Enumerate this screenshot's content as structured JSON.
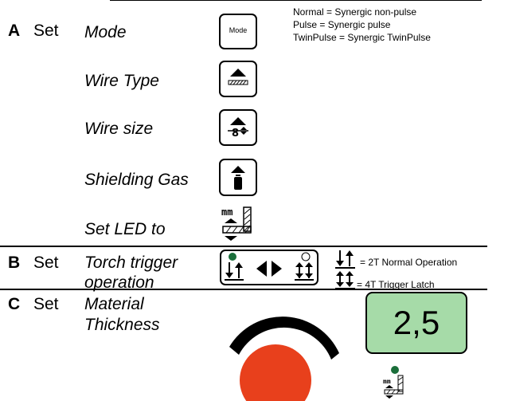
{
  "sections": {
    "a": {
      "letter": "A",
      "set": "Set",
      "rows": [
        {
          "label": "Mode"
        },
        {
          "label": "Wire Type"
        },
        {
          "label": "Wire size"
        },
        {
          "label": "Shielding Gas"
        },
        {
          "label": "Set LED to"
        }
      ],
      "mode_button_label": "Mode",
      "mode_notes": [
        "Normal = Synergic non-pulse",
        "Pulse = Synergic pulse",
        "TwinPulse = Synergic TwinPulse"
      ]
    },
    "b": {
      "letter": "B",
      "set": "Set",
      "label_line1": "Torch trigger",
      "label_line2": "operation",
      "notes": [
        "= 2T Normal Operation",
        "= 4T Trigger Latch"
      ]
    },
    "c": {
      "letter": "C",
      "set": "Set",
      "label_line1": "Material",
      "label_line2": "Thickness",
      "display_value": "2,5",
      "knob_color": "#e8401c",
      "display_color": "#a6dba8",
      "led_color": "#1a6e3a"
    }
  },
  "icons": {
    "mm_text": "mm"
  }
}
